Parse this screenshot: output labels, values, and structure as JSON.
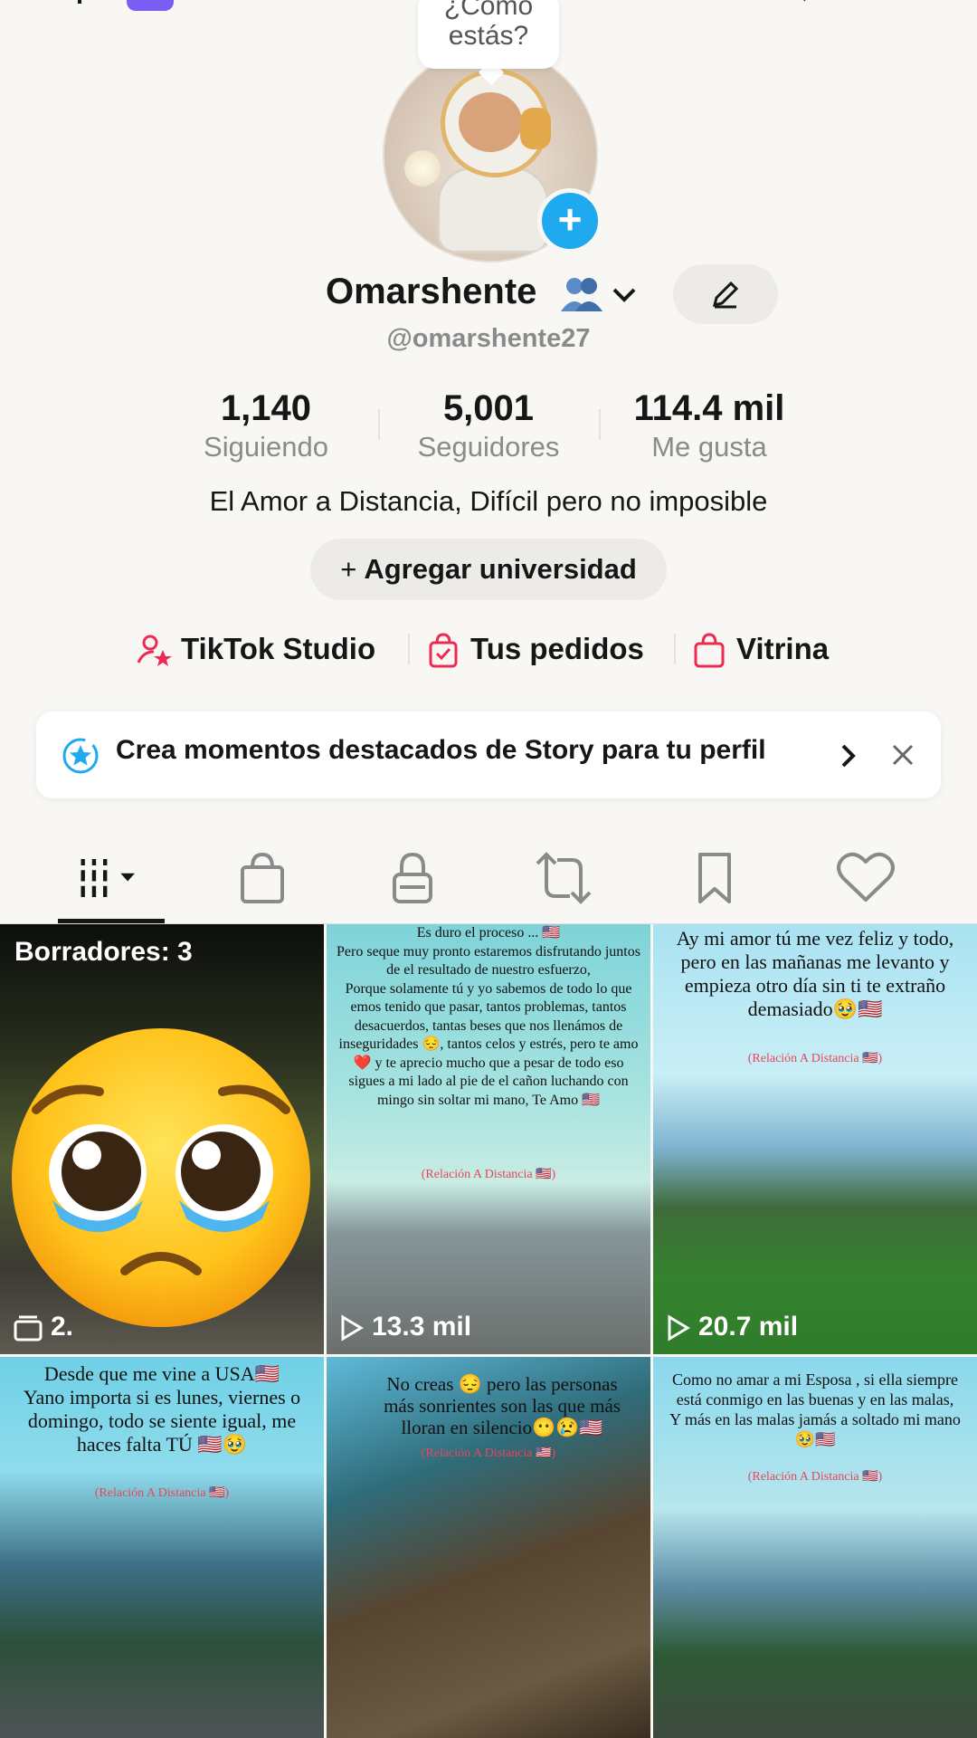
{
  "status": {
    "bubble_text": "¿Cómo estás?"
  },
  "profile": {
    "name": "Omarshente",
    "handle": "@omarshente27",
    "bio": "El Amor a Distancia, Difícil pero no imposible",
    "add_university": "Agregar universidad"
  },
  "stats": [
    {
      "value": "1,140",
      "label": "Siguiendo"
    },
    {
      "value": "5,001",
      "label": "Seguidores"
    },
    {
      "value": "114.4 mil",
      "label": "Me gusta"
    }
  ],
  "links": [
    {
      "label": "TikTok Studio",
      "icon": "creator-icon"
    },
    {
      "label": "Tus pedidos",
      "icon": "orders-bag-icon"
    },
    {
      "label": "Vitrina",
      "icon": "shopping-bag-icon"
    }
  ],
  "banner": {
    "text": "Crea momentos destacados de Story para tu perfil"
  },
  "tabs": [
    {
      "icon": "grid-icon",
      "active": true
    },
    {
      "icon": "shop-bag-icon"
    },
    {
      "icon": "lock-icon"
    },
    {
      "icon": "repost-icon"
    },
    {
      "icon": "bookmark-icon"
    },
    {
      "icon": "heart-icon"
    }
  ],
  "grid": {
    "drafts": "Borradores: 3",
    "draft_count_partial": "2.",
    "videos": [
      {
        "views": "13.3 mil",
        "caption": "Es duro el proceso ... 🇺🇸\nPero seque muy pronto estaremos disfrutando juntos de el resultado de nuestro esfuerzo,\nPorque solamente tú y yo sabemos de todo lo que emos tenido que pasar, tantos problemas, tantos desacuerdos, tantas beses que nos llenámos de inseguridades 😔, tantos celos y estrés, pero te amo ❤️ y te aprecio mucho que a pesar de todo eso sigues a mi lado al pie de el cañon luchando con mingo sin soltar mi mano, Te Amo 🇺🇸",
        "tag": "(Relación A Distancia 🇺🇸)"
      },
      {
        "views": "20.7 mil",
        "caption": "Ay mi amor tú me vez feliz y todo, pero en las mañanas me levanto y empieza otro día sin ti te extraño demasiado🥹🇺🇸",
        "tag": "(Relación A Distancia 🇺🇸)"
      },
      {
        "views": "",
        "caption": "Desde que me vine a USA🇺🇸\nYano importa si es lunes, viernes o domingo, todo se siente igual, me haces falta TÚ 🇺🇸🥹",
        "tag": "(Relación A Distancia 🇺🇸)"
      },
      {
        "views": "",
        "caption": "No creas 😔 pero las personas más sonrientes son las que más lloran en silencio😶😢🇺🇸",
        "tag": "(Relación A Distancia 🇺🇸)"
      },
      {
        "views": "",
        "caption": "Como no amar a mi Esposa , si ella siempre está conmigo en las buenas y en las malas,\nY más en las malas jamás a soltado mi mano 🥹🇺🇸",
        "tag": "(Relación A Distancia 🇺🇸)"
      }
    ]
  }
}
